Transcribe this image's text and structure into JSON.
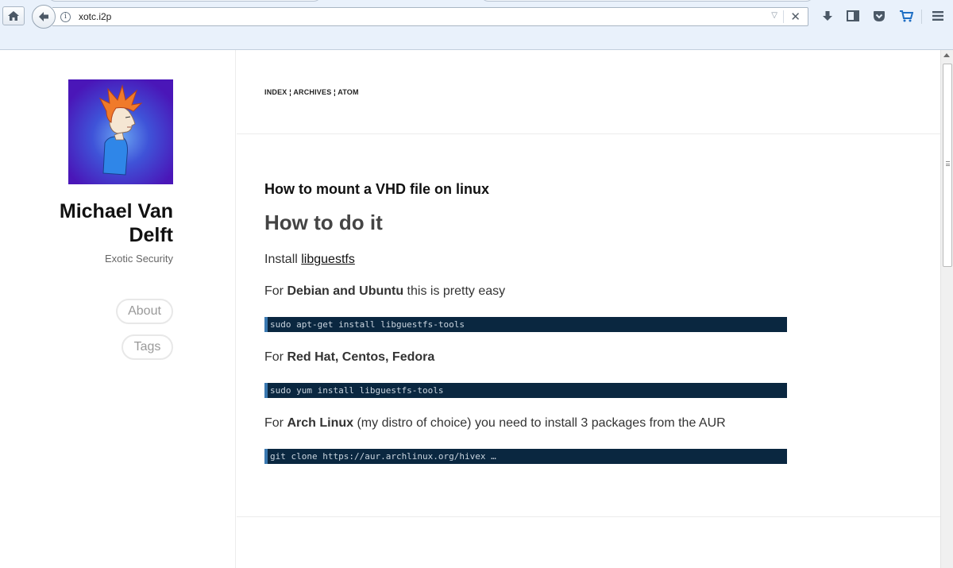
{
  "browser": {
    "url": "xotc.i2p",
    "info_icon_glyph": "i",
    "dropdown_glyph": "▽",
    "stop_glyph": "✕",
    "icons": [
      "home-icon",
      "back-arrow-icon",
      "info-icon",
      "dropdown-icon",
      "stop-icon",
      "download-icon",
      "sidebar-icon",
      "pocket-icon",
      "cart-icon",
      "menu-icon"
    ]
  },
  "sidebar": {
    "name": "Michael Van Delft",
    "tagline": "Exotic Security",
    "links": [
      "About",
      "Tags"
    ]
  },
  "nav": {
    "items": [
      "INDEX",
      "ARCHIVES",
      "ATOM"
    ],
    "separator": " ¦ "
  },
  "post": {
    "title": "How to mount a VHD file on linux",
    "heading": "How to do it",
    "install_prefix": "Install ",
    "install_link": "libguestfs",
    "debian_prefix": "For ",
    "debian_bold": "Debian and Ubuntu",
    "debian_suffix": " this is pretty easy",
    "debian_code": "sudo apt-get install libguestfs-tools",
    "redhat_prefix": "For ",
    "redhat_bold": "Red Hat, Centos, Fedora",
    "redhat_code": "sudo yum install libguestfs-tools",
    "arch_prefix": "For ",
    "arch_bold": "Arch Linux",
    "arch_suffix": " (my distro of choice) you need to install 3 packages from the AUR",
    "arch_code": "git clone https://aur.archlinux.org/hivex …"
  },
  "colors": {
    "chrome_bg": "#e9f1fb",
    "code_bg": "#0a2740",
    "code_accent": "#3a78b0",
    "avatar_bg": "#4a16c8"
  }
}
